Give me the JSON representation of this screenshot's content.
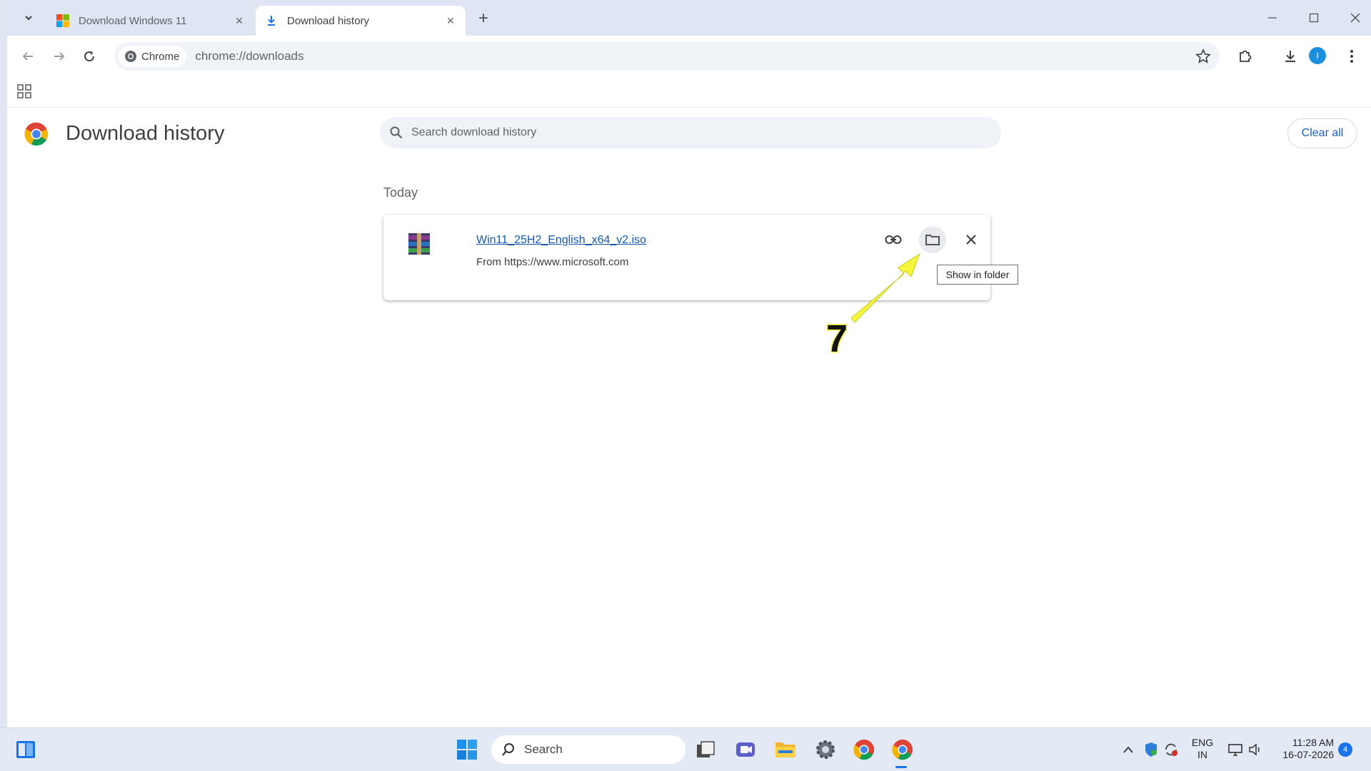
{
  "browser": {
    "tabs": [
      {
        "title": "Download Windows 11",
        "active": false
      },
      {
        "title": "Download history",
        "active": true
      }
    ],
    "omnibox": {
      "chip_label": "Chrome",
      "url": "chrome://downloads"
    }
  },
  "page": {
    "title": "Download history",
    "search_placeholder": "Search download history",
    "clear_all_label": "Clear all",
    "section_label": "Today",
    "download": {
      "file_name": "Win11_25H2_English_x64_v2.iso",
      "source": "From https://www.microsoft.com"
    },
    "tooltip": "Show in folder"
  },
  "annotation": {
    "step_number": "7",
    "arrow_color": "#f5f53c"
  },
  "taskbar": {
    "search_label": "Search",
    "language": {
      "line1": "ENG",
      "line2": "IN"
    },
    "time": "11:28 AM",
    "date": "16-07-2026",
    "notification_count": "4"
  },
  "colors": {
    "accent": "#1a73e8",
    "link": "#1558b0",
    "tabstrip": "#dfe5f3"
  }
}
